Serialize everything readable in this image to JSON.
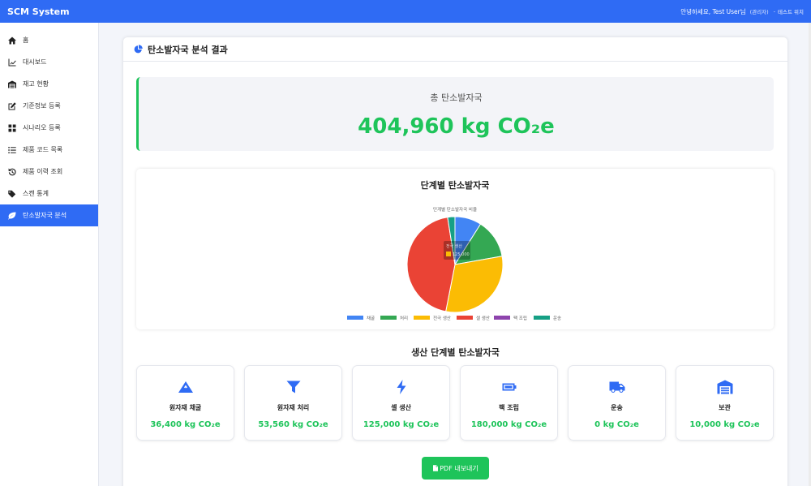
{
  "app": {
    "title": "SCM System"
  },
  "user": {
    "greeting": "안녕하세요, Test User님",
    "role": "(관리자)",
    "separator": "-",
    "site": "테스트 위치"
  },
  "sidebar": {
    "items": [
      {
        "label": "홈",
        "icon": "home-icon"
      },
      {
        "label": "대시보드",
        "icon": "line-chart-icon"
      },
      {
        "label": "재고 현황",
        "icon": "warehouse-icon"
      },
      {
        "label": "기준정보 등록",
        "icon": "edit-icon"
      },
      {
        "label": "시나리오 등록",
        "icon": "grid-icon"
      },
      {
        "label": "제품 코드 목록",
        "icon": "list-icon"
      },
      {
        "label": "제품 이력 조회",
        "icon": "history-icon"
      },
      {
        "label": "스캔 통계",
        "icon": "tags-icon"
      },
      {
        "label": "탄소발자국 분석",
        "icon": "leaf-icon",
        "active": true
      }
    ]
  },
  "main": {
    "title": "탄소발자국 분석 결과",
    "total": {
      "label": "총 탄소발자국",
      "value": "404,960 kg CO₂e"
    },
    "chart_title": "단계별 탄소발자국",
    "stages_title": "생산 단계별 탄소발자국",
    "stages": [
      {
        "name": "원자재 채굴",
        "value": "36,400 kg CO₂e",
        "icon": "mountain-icon"
      },
      {
        "name": "원자재 처리",
        "value": "53,560 kg CO₂e",
        "icon": "filter-icon"
      },
      {
        "name": "셀 생산",
        "value": "125,000 kg CO₂e",
        "icon": "bolt-icon"
      },
      {
        "name": "팩 조립",
        "value": "180,000 kg CO₂e",
        "icon": "battery-icon"
      },
      {
        "name": "운송",
        "value": "0 kg CO₂e",
        "icon": "truck-icon"
      },
      {
        "name": "보관",
        "value": "10,000 kg CO₂e",
        "icon": "warehouse-icon"
      }
    ],
    "export_button": "PDF 내보내기"
  },
  "colors": {
    "primary": "#2f6bf4",
    "accent_green": "#1ec45a"
  },
  "chart_data": {
    "type": "pie",
    "title": "단계별 탄소발자국 비율",
    "legend_position": "bottom",
    "categories": [
      "채굴",
      "처리",
      "전극 생산",
      "셀 생산",
      "팩 조립",
      "운송"
    ],
    "values": [
      36400,
      53560,
      125000,
      180000,
      0,
      10000
    ],
    "colors": [
      "#4285f4",
      "#34a853",
      "#fbbc04",
      "#ea4335",
      "#8e44ad",
      "#16a085"
    ],
    "tooltip": {
      "label": "전극 생산",
      "value": "125,000"
    }
  }
}
